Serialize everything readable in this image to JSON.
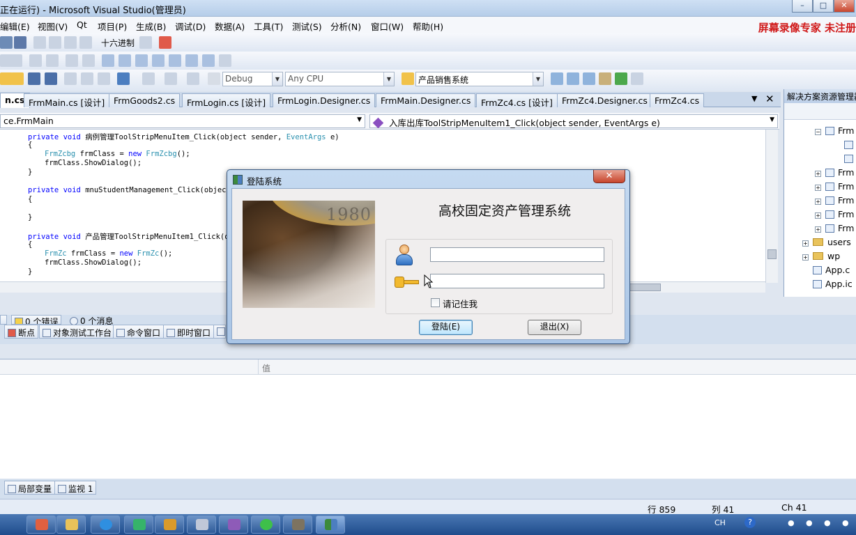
{
  "window": {
    "title": "正在运行) - Microsoft Visual Studio(管理员)",
    "recorder_watermark": "屏幕录像专家 未注册"
  },
  "menu": [
    "编辑(E)",
    "视图(V)",
    "Qt",
    "项目(P)",
    "生成(B)",
    "调试(D)",
    "数据(A)",
    "工具(T)",
    "测试(S)",
    "分析(N)",
    "窗口(W)",
    "帮助(H)"
  ],
  "toolbar": {
    "hex_label": "十六进制",
    "config": "Debug",
    "platform": "Any CPU",
    "startup_project": "产品销售系统"
  },
  "tabs": [
    "n.cs",
    "FrmMain.cs [设计]",
    "FrmGoods2.cs",
    "FrmLogin.cs [设计]",
    "FrmLogin.Designer.cs",
    "FrmMain.Designer.cs",
    "FrmZc4.cs [设计]",
    "FrmZc4.Designer.cs",
    "FrmZc4.cs"
  ],
  "navbar": {
    "class": "ce.FrmMain",
    "member": "入库出库ToolStripMenuItem1_Click(object sender, EventArgs e)"
  },
  "code": {
    "l1a": "private void ",
    "l1b": "病例管理ToolStripMenuItem_Click(object sender, ",
    "l1c": "EventArgs",
    "l1d": " e)",
    "l3a": "FrmZcbg",
    "l3b": " frmClass = ",
    "l3c": "new ",
    "l3d": "FrmZcbg",
    "l3e": "();",
    "l4": "frmClass.ShowDialog();",
    "l7": "mnuStudentManagement_Click(object",
    "l10": "产品管理ToolStripMenuItem1_Click(o",
    "l12a": "FrmZc",
    "l12b": " frmClass = ",
    "l12c": "FrmZc",
    "l12d": "();",
    "brace_open": "{",
    "brace_close": "}"
  },
  "solution_explorer": {
    "title": "解决方案资源管理器",
    "nodes": [
      "Frm",
      "Frm",
      "Frm",
      "Frm",
      "Frm",
      "Frm",
      "users",
      "wp",
      "App.c",
      "App.ic"
    ]
  },
  "panels": {
    "errors_label": "0 个错误",
    "messages_label": "0 个消息",
    "tabs_top": [
      "断点",
      "对象测试工作台",
      "命令窗口",
      "即时窗口"
    ],
    "locals_value_col": "值",
    "tabs_bottom": [
      "局部变量",
      "监视 1"
    ]
  },
  "status": {
    "line": "行 859",
    "col": "列 41",
    "ch": "Ch 41"
  },
  "tray": {
    "ime": "CH"
  },
  "dialog": {
    "title": "登陆系统",
    "close": "✕",
    "system_name": "高校固定资产管理系统",
    "coin_text": "1980",
    "username": "",
    "password": "",
    "remember_label": "请记住我",
    "remember_checked": false,
    "login_button": "登陆(E)",
    "exit_button": "退出(X)"
  },
  "colors": {
    "accent": "#3c7fb1",
    "watermark": "#d01818",
    "keyword": "#0000ff",
    "type": "#2b91af"
  }
}
